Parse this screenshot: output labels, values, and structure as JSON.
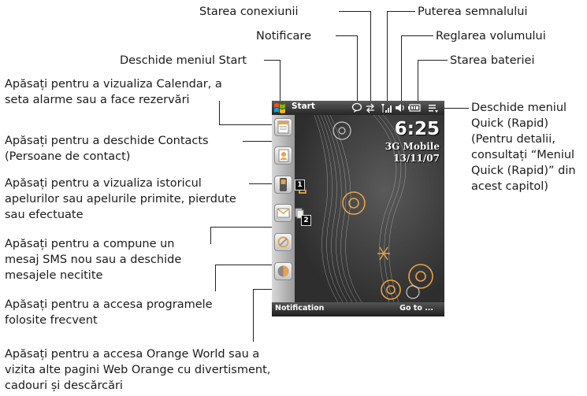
{
  "callouts": {
    "connection_status": "Starea conexiunii",
    "signal_strength": "Puterea semnalului",
    "notification": "Notificare",
    "volume_control": "Reglarea volumului",
    "open_start_menu": "Deschide meniul Start",
    "battery_status": "Starea bateriei",
    "calendar": [
      "Apăsați pentru a vizualiza Calendar, a",
      "seta alarme sau a face rezervări"
    ],
    "contacts": [
      "Apăsați pentru a deschide Contacts",
      "(Persoane de contact)"
    ],
    "call_history": [
      "Apăsați pentru a vizualiza istoricul",
      "apelurilor sau apelurile primite, pierdute",
      "sau efectuate"
    ],
    "sms": [
      "Apăsați pentru a compune un",
      "mesaj SMS nou sau a deschide",
      "mesajele necitite"
    ],
    "programs": [
      "Apăsați pentru a accesa programele",
      "folosite frecvent"
    ],
    "orange_world": [
      "Apăsați pentru a accesa Orange World sau a",
      "vizita alte pagini Web Orange cu divertisment,",
      "cadouri și descărcări"
    ],
    "quick_menu": [
      "Deschide meniul",
      "Quick (Rapid)",
      "(Pentru detalii,",
      "consultați “Meniul",
      "Quick (Rapid)” din",
      "acest capitol)"
    ]
  },
  "phone": {
    "title": "Start",
    "clock": "6:25",
    "operator": "3G Mobile",
    "date": "13/11/07",
    "softkey_left": "Notification",
    "softkey_right": "Go to ...",
    "badge_missed_calls": "1",
    "badge_messages": "2"
  },
  "icons": {
    "titlebar": [
      "windows-start-icon",
      "notification-icon",
      "connection-icon",
      "signal-icon",
      "volume-icon",
      "battery-icon",
      "quick-menu-icon"
    ],
    "sidebar": [
      "calendar-icon",
      "contacts-icon",
      "call-history-icon",
      "messaging-icon",
      "programs-icon",
      "orange-world-icon"
    ]
  },
  "colors": {
    "background": "#ffffff",
    "text": "#1a1a1a",
    "phone_bar": "#262626",
    "accent_orange": "#e8a24a"
  }
}
